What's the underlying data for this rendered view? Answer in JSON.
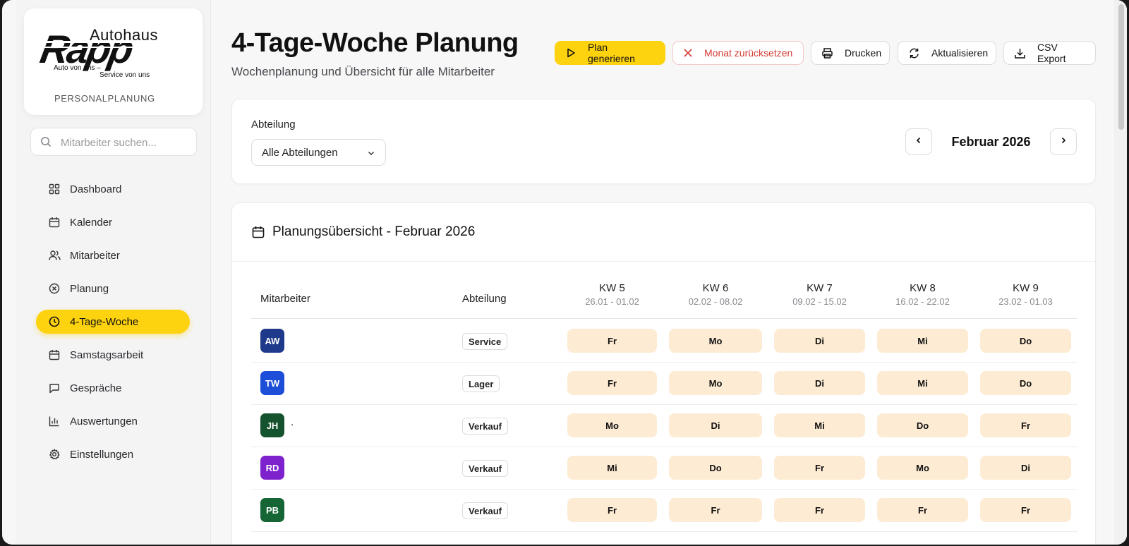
{
  "brand": {
    "autohaus": "Autohaus",
    "rapp": "Rapp",
    "tag1": "Auto von uns –",
    "tag2": "Service von uns",
    "section": "PERSONALPLANUNG"
  },
  "search": {
    "placeholder": "Mitarbeiter suchen..."
  },
  "nav": [
    {
      "label": "Dashboard",
      "icon": "dashboard-icon"
    },
    {
      "label": "Kalender",
      "icon": "calendar-icon"
    },
    {
      "label": "Mitarbeiter",
      "icon": "users-icon"
    },
    {
      "label": "Planung",
      "icon": "circle-x-icon"
    },
    {
      "label": "4-Tage-Woche",
      "icon": "clock-icon",
      "active": true
    },
    {
      "label": "Samstagsarbeit",
      "icon": "calendar-icon"
    },
    {
      "label": "Gespräche",
      "icon": "chat-icon"
    },
    {
      "label": "Auswertungen",
      "icon": "bar-chart-icon"
    },
    {
      "label": "Einstellungen",
      "icon": "gear-icon"
    }
  ],
  "header": {
    "title": "4-Tage-Woche Planung",
    "subtitle": "Wochenplanung und Übersicht für alle Mitarbeiter"
  },
  "toolbar": {
    "generate": "Plan generieren",
    "reset": "Monat zurücksetzen",
    "print": "Drucken",
    "refresh": "Aktualisieren",
    "csv": "CSV Export"
  },
  "filter": {
    "label": "Abteilung",
    "selected": "Alle Abteilungen",
    "month": "Februar 2026"
  },
  "plan": {
    "title_prefix": "Planungsübersicht - ",
    "title_month": "Februar 2026",
    "col_employee": "Mitarbeiter",
    "col_department": "Abteilung",
    "weeks": [
      {
        "kw": "KW 5",
        "range": "26.01 - 01.02"
      },
      {
        "kw": "KW 6",
        "range": "02.02 - 08.02"
      },
      {
        "kw": "KW 7",
        "range": "09.02 - 15.02"
      },
      {
        "kw": "KW 8",
        "range": "16.02 - 22.02"
      },
      {
        "kw": "KW 9",
        "range": "23.02 - 01.03"
      }
    ],
    "rows": [
      {
        "initials": "AW",
        "name": "",
        "color": "#1f3a8a",
        "department": "Service",
        "days": [
          "Fr",
          "Mo",
          "Di",
          "Mi",
          "Do"
        ]
      },
      {
        "initials": "TW",
        "name": "",
        "color": "#1d4ed8",
        "department": "Lager",
        "days": [
          "Fr",
          "Mo",
          "Di",
          "Mi",
          "Do"
        ]
      },
      {
        "initials": "JH",
        "name": ".",
        "color": "#14532d",
        "department": "Verkauf",
        "days": [
          "Mo",
          "Di",
          "Mi",
          "Do",
          "Fr"
        ]
      },
      {
        "initials": "RD",
        "name": "",
        "color": "#7e22ce",
        "department": "Verkauf",
        "days": [
          "Mi",
          "Do",
          "Fr",
          "Mo",
          "Di"
        ]
      },
      {
        "initials": "PB",
        "name": "",
        "color": "#166534",
        "department": "Verkauf",
        "days": [
          "Fr",
          "Fr",
          "Fr",
          "Fr",
          "Fr"
        ]
      }
    ]
  },
  "colors": {
    "accent": "#fdd20e",
    "day_cell": "#fdebd3",
    "danger": "#d43b32"
  }
}
